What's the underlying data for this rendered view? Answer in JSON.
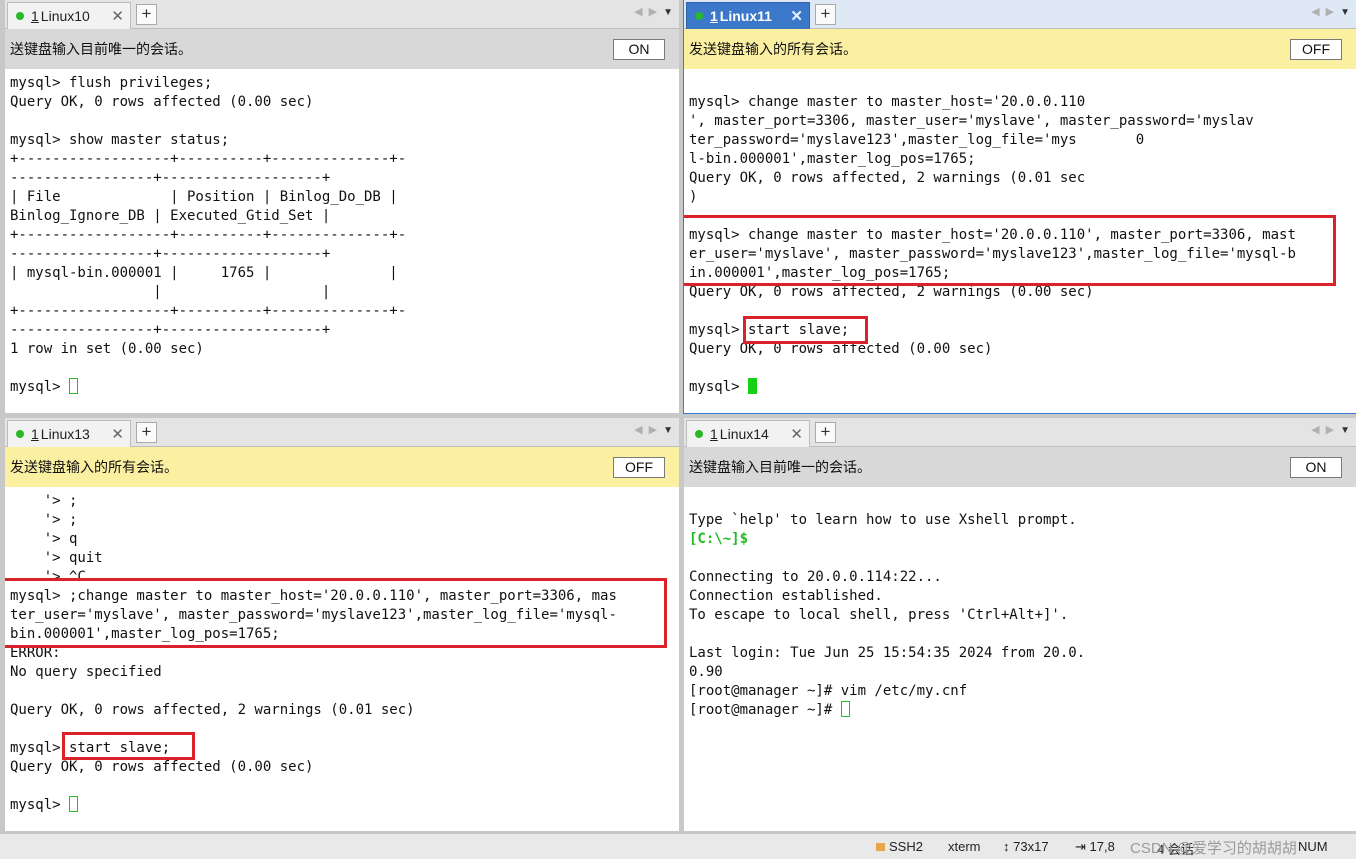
{
  "panes": [
    {
      "tab": {
        "number": "1",
        "name": "Linux10"
      },
      "notice": "送键盘输入目前唯一的会话。",
      "toggle": "ON",
      "lines": [
        "mysql> flush privileges;",
        "Query OK, 0 rows affected (0.00 sec)",
        "",
        "mysql> show master status;",
        "+------------------+----------+--------------+-",
        "-----------------+-------------------+",
        "| File             | Position | Binlog_Do_DB |",
        "Binlog_Ignore_DB | Executed_Gtid_Set |",
        "+------------------+----------+--------------+-",
        "-----------------+-------------------+",
        "| mysql-bin.000001 |     1765 |              |",
        "                 |                   |",
        "+------------------+----------+--------------+-",
        "-----------------+-------------------+",
        "1 row in set (0.00 sec)",
        "",
        "mysql> "
      ]
    },
    {
      "tab": {
        "number": "1",
        "name": "Linux11"
      },
      "notice": "发送键盘输入的所有会话。",
      "toggle": "OFF",
      "lines": [
        "",
        "mysql> change master to master_host='20.0.0.110",
        "', master_port=3306, master_user='myslave', master_password='myslav",
        "ter_password='myslave123',master_log_file='mys       0",
        "l-bin.000001',master_log_pos=1765;",
        "Query OK, 0 rows affected, 2 warnings (0.01 sec",
        ")",
        "",
        "mysql> change master to master_host='20.0.0.110', master_port=3306, mast",
        "er_user='myslave', master_password='myslave123',master_log_file='mysql-b",
        "in.000001',master_log_pos=1765;",
        "Query OK, 0 rows affected, 2 warnings (0.00 sec)",
        "",
        "mysql> start slave;",
        "Query OK, 0 rows affected (0.00 sec)",
        "",
        "mysql> "
      ]
    },
    {
      "tab": {
        "number": "1",
        "name": "Linux13"
      },
      "notice": "发送键盘输入的所有会话。",
      "toggle": "OFF",
      "lines": [
        "    '> ;",
        "    '> ;",
        "    '> q",
        "    '> quit",
        "    '> ^C",
        "mysql> ;change master to master_host='20.0.0.110', master_port=3306, mas",
        "ter_user='myslave', master_password='myslave123',master_log_file='mysql-",
        "bin.000001',master_log_pos=1765;",
        "ERROR:",
        "No query specified",
        "",
        "Query OK, 0 rows affected, 2 warnings (0.01 sec)",
        "",
        "mysql> start slave;",
        "Query OK, 0 rows affected (0.00 sec)",
        "",
        "mysql> "
      ]
    },
    {
      "tab": {
        "number": "1",
        "name": "Linux14"
      },
      "notice": "送键盘输入目前唯一的会话。",
      "toggle": "ON",
      "lines": [
        "",
        "Type `help' to learn how to use Xshell prompt.",
        "[C:\\~]$",
        "",
        "Connecting to 20.0.0.114:22...",
        "Connection established.",
        "To escape to local shell, press 'Ctrl+Alt+]'.",
        "",
        "Last login: Tue Jun 25 15:54:35 2024 from 20.0.",
        "0.90",
        "[root@manager ~]# vim /etc/my.cnf",
        "[root@manager ~]# "
      ]
    }
  ],
  "statusbar": {
    "protocol": "SSH2",
    "term": "xterm",
    "size": "73x17",
    "cursor_pos": "17,8",
    "sessions": "4 会话",
    "watermark": "CSDN @爱学习的胡胡胡",
    "num": "NUM"
  }
}
